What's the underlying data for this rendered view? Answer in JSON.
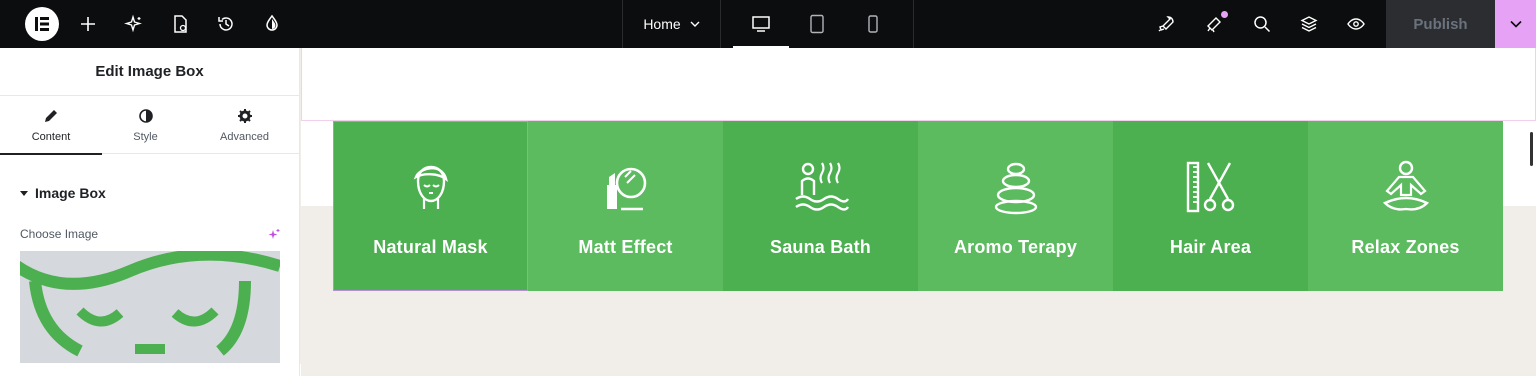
{
  "topbar": {
    "page_name": "Home",
    "publish_label": "Publish",
    "icons": [
      "elementor-logo-icon",
      "add-icon",
      "ai-sparkle-icon",
      "page-settings-icon",
      "history-icon",
      "theme-style-icon",
      "rocket-icon",
      "notifications-icon",
      "search-icon",
      "structure-icon",
      "preview-icon"
    ],
    "devices": [
      "desktop-icon",
      "tablet-icon",
      "mobile-icon"
    ]
  },
  "panel": {
    "title": "Edit Image Box",
    "tabs": [
      {
        "label": "Content",
        "icon": "pencil-icon"
      },
      {
        "label": "Style",
        "icon": "contrast-icon"
      },
      {
        "label": "Advanced",
        "icon": "gear-icon"
      }
    ],
    "section_title": "Image Box",
    "choose_image_label": "Choose Image"
  },
  "canvas": {
    "boxes": [
      {
        "title": "Natural Mask",
        "icon": "face-mask-icon"
      },
      {
        "title": "Matt Effect",
        "icon": "makeup-mirror-icon"
      },
      {
        "title": "Sauna Bath",
        "icon": "sauna-icon"
      },
      {
        "title": "Aromo Terapy",
        "icon": "spa-stones-icon"
      },
      {
        "title": "Hair Area",
        "icon": "comb-scissors-icon"
      },
      {
        "title": "Relax Zones",
        "icon": "meditation-icon"
      }
    ]
  },
  "colors": {
    "accent": "#e6a3f5",
    "box_green": "#4caf50",
    "box_green_light": "#5cba5f",
    "topbar": "#0c0d0e"
  }
}
